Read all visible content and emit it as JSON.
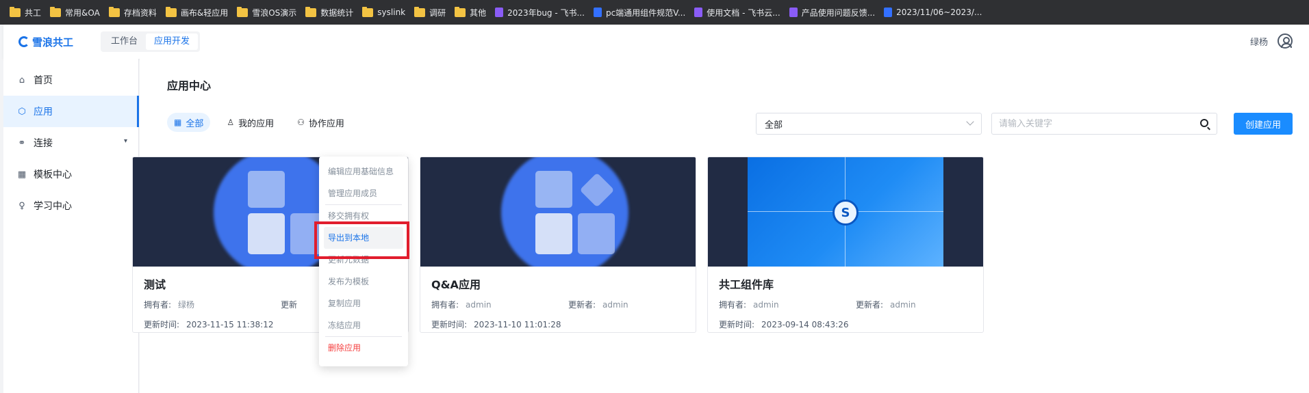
{
  "bookmarks": [
    {
      "label": "共工",
      "icon": "folder-icon"
    },
    {
      "label": "常用&OA",
      "icon": "folder-icon"
    },
    {
      "label": "存档资料",
      "icon": "folder-icon"
    },
    {
      "label": "画布&轻应用",
      "icon": "folder-icon"
    },
    {
      "label": "雪浪OS演示",
      "icon": "folder-icon"
    },
    {
      "label": "数据统计",
      "icon": "folder-icon"
    },
    {
      "label": "syslink",
      "icon": "folder-icon"
    },
    {
      "label": "调研",
      "icon": "folder-icon"
    },
    {
      "label": "其他",
      "icon": "folder-icon"
    },
    {
      "label": "2023年bug - 飞书...",
      "icon": "sheet-icon"
    },
    {
      "label": "pc端通用组件规范V...",
      "icon": "doc-icon"
    },
    {
      "label": "使用文档 - 飞书云...",
      "icon": "sheet-icon"
    },
    {
      "label": "产品使用问题反馈...",
      "icon": "sheet-icon"
    },
    {
      "label": "2023/11/06~2023/...",
      "icon": "doc-icon"
    }
  ],
  "header": {
    "logo": "雪浪共工",
    "tabs": [
      {
        "label": "工作台"
      },
      {
        "label": "应用开发"
      }
    ],
    "user_name": "绿杨"
  },
  "sidebar": {
    "items": [
      {
        "label": "首页",
        "icon": "home-icon"
      },
      {
        "label": "应用",
        "icon": "cube-icon"
      },
      {
        "label": "连接",
        "icon": "link-icon"
      },
      {
        "label": "模板中心",
        "icon": "grid-icon"
      },
      {
        "label": "学习中心",
        "icon": "bulb-icon"
      }
    ]
  },
  "main": {
    "title": "应用中心",
    "filters": [
      {
        "label": "全部"
      },
      {
        "label": "我的应用"
      },
      {
        "label": "协作应用"
      }
    ],
    "select_value": "全部",
    "search_placeholder": "请输入关键字",
    "create_label": "创建应用"
  },
  "labels": {
    "owner": "拥有者:",
    "updater": "更新者:",
    "update_time": "更新时间:"
  },
  "cards": [
    {
      "title": "测试",
      "owner": "绿杨",
      "updater_label": "更新",
      "time": "2023-11-15 11:38:12"
    },
    {
      "title": "Q&A应用",
      "owner": "admin",
      "updater": "admin",
      "time": "2023-11-10 11:01:28"
    },
    {
      "title": "共工组件库",
      "owner": "admin",
      "updater": "admin",
      "time": "2023-09-14 08:43:26"
    }
  ],
  "menu": {
    "items": [
      "编辑应用基础信息",
      "管理应用成员",
      "移交拥有权",
      "导出到本地",
      "更新元数据",
      "发布为模板",
      "复制应用",
      "冻结应用",
      "删除应用"
    ]
  },
  "colors": {
    "accent": "#1a73e8",
    "button": "#1a8cff",
    "danger": "#f53f3f",
    "highlight": "#e11d2d"
  }
}
